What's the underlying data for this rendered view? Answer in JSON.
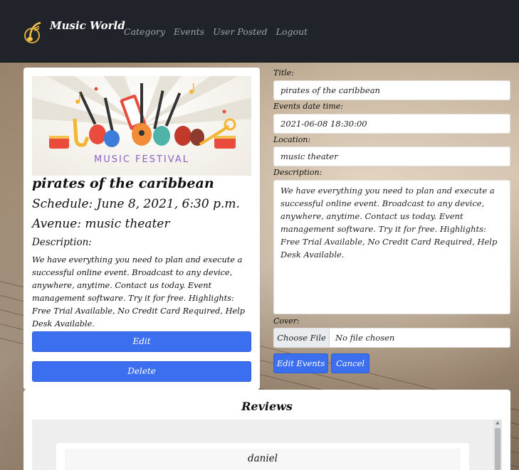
{
  "navbar": {
    "brand": "Music World",
    "links": [
      "Category",
      "Events",
      "User Posted",
      "Logout"
    ]
  },
  "event": {
    "poster_text": "MUSIC FESTIVAL",
    "title": "pirates of the caribbean",
    "schedule": "Schedule: June 8, 2021, 6:30 p.m.",
    "venue": "Avenue: music theater",
    "description_label": "Description:",
    "description": "We have everything you need to plan and execute a successful online event. Broadcast to any device, anywhere, anytime. Contact us today. Event management software. Try it for free. Highlights: Free Trial Available, No Credit Card Required, Help Desk Available.",
    "edit_label": "Edit",
    "delete_label": "Delete"
  },
  "form": {
    "title_label": "Title:",
    "title_value": "pirates of the caribbean",
    "datetime_label": "Events date time:",
    "datetime_value": "2021-06-08 18:30:00",
    "location_label": "Location:",
    "location_value": "music theater",
    "description_label": "Description:",
    "description_value": "We have everything you need to plan and execute a successful online event. Broadcast to any device, anywhere, anytime. Contact us today. Event management software. Try it for free. Highlights: Free Trial Available, No Credit Card Required, Help Desk Available.",
    "cover_label": "Cover:",
    "choose_file_label": "Choose File",
    "file_status": "No file chosen",
    "submit_label": "Edit Events",
    "cancel_label": "Cancel"
  },
  "reviews": {
    "title": "Reviews",
    "items": [
      {
        "author": "daniel"
      }
    ]
  },
  "colors": {
    "navbar_bg": "#20232a",
    "primary": "#3b6ff0",
    "page_text": "#111111"
  },
  "icons": {
    "logo": "music-note-logo-icon"
  }
}
